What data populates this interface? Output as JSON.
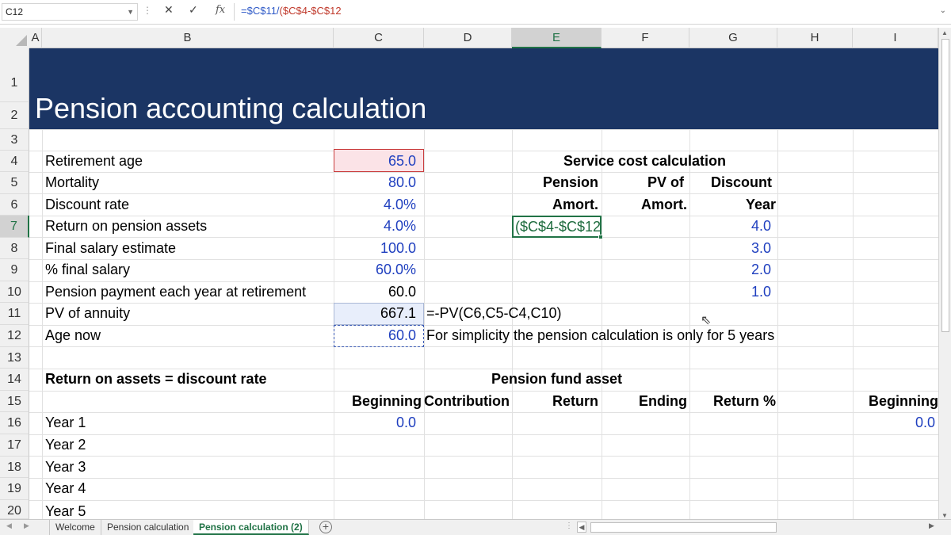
{
  "formula_bar": {
    "name_box": "C12",
    "cancel_icon": "✕",
    "enter_icon": "✓",
    "fx_label": "fx",
    "formula_part1": "=$C$11/",
    "formula_part2": "($C$4-$C$12"
  },
  "columns": [
    "A",
    "B",
    "C",
    "D",
    "E",
    "F",
    "G",
    "H",
    "I"
  ],
  "selected_column": "E",
  "rows": [
    "1",
    "2",
    "3",
    "4",
    "5",
    "6",
    "7",
    "8",
    "9",
    "10",
    "11",
    "12",
    "13",
    "14",
    "15",
    "16",
    "17",
    "18",
    "19",
    "20"
  ],
  "selected_row": "7",
  "banner": {
    "title": "Pension accounting calculation",
    "color": "#1b3564"
  },
  "inputs": {
    "labels": [
      "Retirement age",
      "Mortality",
      "Discount rate",
      "Return on pension assets",
      "Final salary estimate",
      "% final salary",
      "Pension payment each year at retirement",
      "PV of annuity",
      "Age now"
    ],
    "values": [
      "65.0",
      "80.0",
      "4.0%",
      "4.0%",
      "100.0",
      "60.0%",
      "60.0",
      "667.1",
      "60.0"
    ]
  },
  "notes": {
    "pv_formula": "=-PV(C6,C5-C4,C10)",
    "simplicity": "For simplicity the pension calculation is only for 5 years"
  },
  "service_cost": {
    "title": "Service cost calculation",
    "h_pension": "Pension",
    "h_pv_of": "PV of",
    "h_discount": "Discount",
    "h_amort": "Amort.",
    "h_amort2": "Amort.",
    "h_year": "Year",
    "editing_value": "($C$4-$C$12",
    "years": [
      "4.0",
      "3.0",
      "2.0",
      "1.0"
    ]
  },
  "fund_section": {
    "left_title": "Return on assets = discount rate",
    "title": "Pension fund asset",
    "headers": [
      "Beginning",
      "Contribution",
      "Return",
      "Ending",
      "Return %"
    ],
    "header_right": "Beginning",
    "years": [
      "Year 1",
      "Year 2",
      "Year 3",
      "Year 4",
      "Year 5"
    ],
    "year1_beginning": "0.0",
    "right_beginning": "0.0"
  },
  "sheet_tabs": [
    "Welcome",
    "Pension calculation",
    "Pension calculation (2)"
  ],
  "active_tab": "Pension calculation (2)",
  "colors": {
    "accent": "#217346",
    "input_blue": "#1f3fbf",
    "banner": "#1b3564"
  }
}
